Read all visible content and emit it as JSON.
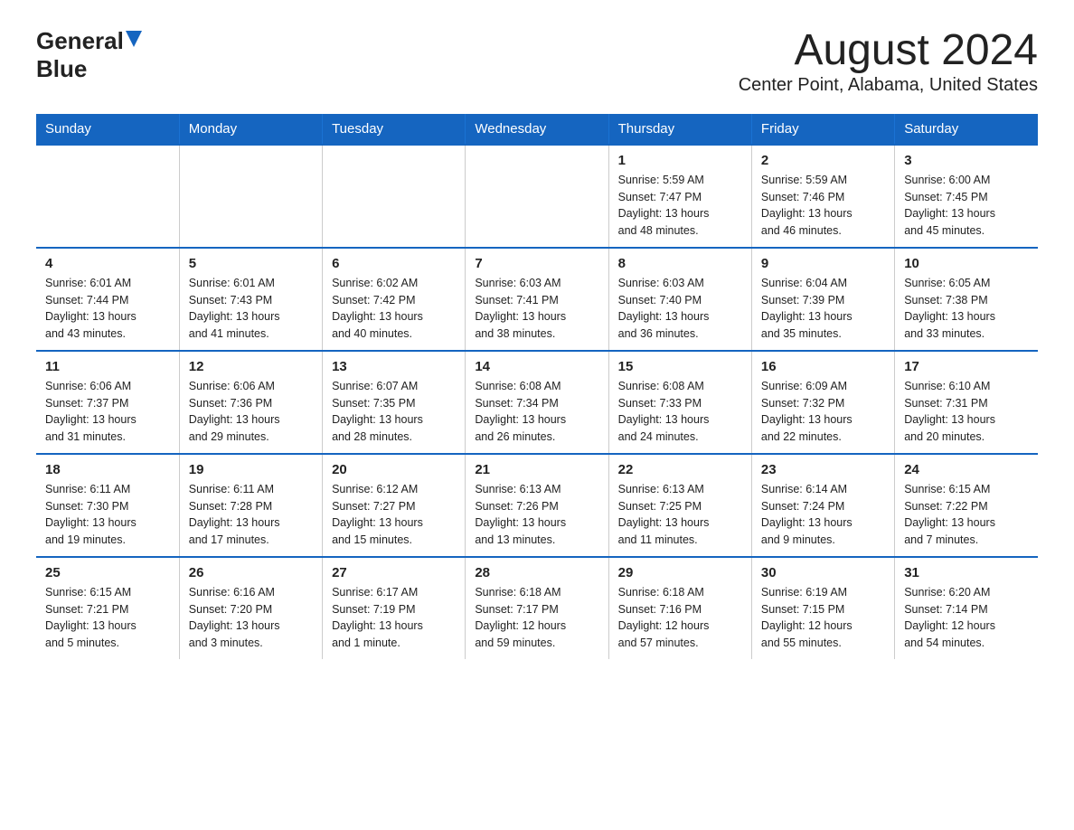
{
  "header": {
    "logo_general": "General",
    "logo_blue": "Blue",
    "title": "August 2024",
    "subtitle": "Center Point, Alabama, United States"
  },
  "days_of_week": [
    "Sunday",
    "Monday",
    "Tuesday",
    "Wednesday",
    "Thursday",
    "Friday",
    "Saturday"
  ],
  "weeks": [
    [
      {
        "day": "",
        "info": ""
      },
      {
        "day": "",
        "info": ""
      },
      {
        "day": "",
        "info": ""
      },
      {
        "day": "",
        "info": ""
      },
      {
        "day": "1",
        "info": "Sunrise: 5:59 AM\nSunset: 7:47 PM\nDaylight: 13 hours\nand 48 minutes."
      },
      {
        "day": "2",
        "info": "Sunrise: 5:59 AM\nSunset: 7:46 PM\nDaylight: 13 hours\nand 46 minutes."
      },
      {
        "day": "3",
        "info": "Sunrise: 6:00 AM\nSunset: 7:45 PM\nDaylight: 13 hours\nand 45 minutes."
      }
    ],
    [
      {
        "day": "4",
        "info": "Sunrise: 6:01 AM\nSunset: 7:44 PM\nDaylight: 13 hours\nand 43 minutes."
      },
      {
        "day": "5",
        "info": "Sunrise: 6:01 AM\nSunset: 7:43 PM\nDaylight: 13 hours\nand 41 minutes."
      },
      {
        "day": "6",
        "info": "Sunrise: 6:02 AM\nSunset: 7:42 PM\nDaylight: 13 hours\nand 40 minutes."
      },
      {
        "day": "7",
        "info": "Sunrise: 6:03 AM\nSunset: 7:41 PM\nDaylight: 13 hours\nand 38 minutes."
      },
      {
        "day": "8",
        "info": "Sunrise: 6:03 AM\nSunset: 7:40 PM\nDaylight: 13 hours\nand 36 minutes."
      },
      {
        "day": "9",
        "info": "Sunrise: 6:04 AM\nSunset: 7:39 PM\nDaylight: 13 hours\nand 35 minutes."
      },
      {
        "day": "10",
        "info": "Sunrise: 6:05 AM\nSunset: 7:38 PM\nDaylight: 13 hours\nand 33 minutes."
      }
    ],
    [
      {
        "day": "11",
        "info": "Sunrise: 6:06 AM\nSunset: 7:37 PM\nDaylight: 13 hours\nand 31 minutes."
      },
      {
        "day": "12",
        "info": "Sunrise: 6:06 AM\nSunset: 7:36 PM\nDaylight: 13 hours\nand 29 minutes."
      },
      {
        "day": "13",
        "info": "Sunrise: 6:07 AM\nSunset: 7:35 PM\nDaylight: 13 hours\nand 28 minutes."
      },
      {
        "day": "14",
        "info": "Sunrise: 6:08 AM\nSunset: 7:34 PM\nDaylight: 13 hours\nand 26 minutes."
      },
      {
        "day": "15",
        "info": "Sunrise: 6:08 AM\nSunset: 7:33 PM\nDaylight: 13 hours\nand 24 minutes."
      },
      {
        "day": "16",
        "info": "Sunrise: 6:09 AM\nSunset: 7:32 PM\nDaylight: 13 hours\nand 22 minutes."
      },
      {
        "day": "17",
        "info": "Sunrise: 6:10 AM\nSunset: 7:31 PM\nDaylight: 13 hours\nand 20 minutes."
      }
    ],
    [
      {
        "day": "18",
        "info": "Sunrise: 6:11 AM\nSunset: 7:30 PM\nDaylight: 13 hours\nand 19 minutes."
      },
      {
        "day": "19",
        "info": "Sunrise: 6:11 AM\nSunset: 7:28 PM\nDaylight: 13 hours\nand 17 minutes."
      },
      {
        "day": "20",
        "info": "Sunrise: 6:12 AM\nSunset: 7:27 PM\nDaylight: 13 hours\nand 15 minutes."
      },
      {
        "day": "21",
        "info": "Sunrise: 6:13 AM\nSunset: 7:26 PM\nDaylight: 13 hours\nand 13 minutes."
      },
      {
        "day": "22",
        "info": "Sunrise: 6:13 AM\nSunset: 7:25 PM\nDaylight: 13 hours\nand 11 minutes."
      },
      {
        "day": "23",
        "info": "Sunrise: 6:14 AM\nSunset: 7:24 PM\nDaylight: 13 hours\nand 9 minutes."
      },
      {
        "day": "24",
        "info": "Sunrise: 6:15 AM\nSunset: 7:22 PM\nDaylight: 13 hours\nand 7 minutes."
      }
    ],
    [
      {
        "day": "25",
        "info": "Sunrise: 6:15 AM\nSunset: 7:21 PM\nDaylight: 13 hours\nand 5 minutes."
      },
      {
        "day": "26",
        "info": "Sunrise: 6:16 AM\nSunset: 7:20 PM\nDaylight: 13 hours\nand 3 minutes."
      },
      {
        "day": "27",
        "info": "Sunrise: 6:17 AM\nSunset: 7:19 PM\nDaylight: 13 hours\nand 1 minute."
      },
      {
        "day": "28",
        "info": "Sunrise: 6:18 AM\nSunset: 7:17 PM\nDaylight: 12 hours\nand 59 minutes."
      },
      {
        "day": "29",
        "info": "Sunrise: 6:18 AM\nSunset: 7:16 PM\nDaylight: 12 hours\nand 57 minutes."
      },
      {
        "day": "30",
        "info": "Sunrise: 6:19 AM\nSunset: 7:15 PM\nDaylight: 12 hours\nand 55 minutes."
      },
      {
        "day": "31",
        "info": "Sunrise: 6:20 AM\nSunset: 7:14 PM\nDaylight: 12 hours\nand 54 minutes."
      }
    ]
  ]
}
